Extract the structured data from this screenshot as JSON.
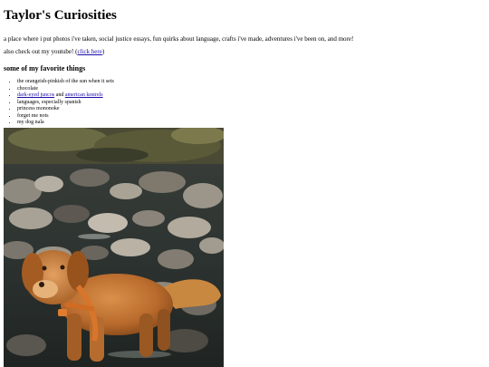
{
  "site": {
    "title": "Taylor's Curiosities",
    "description": "a place where i put photos i've taken, social justice essays, fun quirks about language, crafts i've made, adventures i've been on, and more!"
  },
  "youtube": {
    "prefix": "also check out my youtube! (",
    "link_text": "click here",
    "suffix": ")"
  },
  "favorites": {
    "heading": "some of my favorite things",
    "items": [
      {
        "text": "the orangeish-pinkish of the sun when it sets"
      },
      {
        "text": "chocolate"
      },
      {
        "link1": "dark-eyed juncos",
        "middle": " and ",
        "link2": "american kestrels"
      },
      {
        "text": "languages, especially spanish"
      },
      {
        "text": "princess mononoke"
      },
      {
        "text": "forget me nots"
      },
      {
        "text": "my dog nala"
      }
    ]
  },
  "photo": {
    "icon": "dog-photo"
  }
}
